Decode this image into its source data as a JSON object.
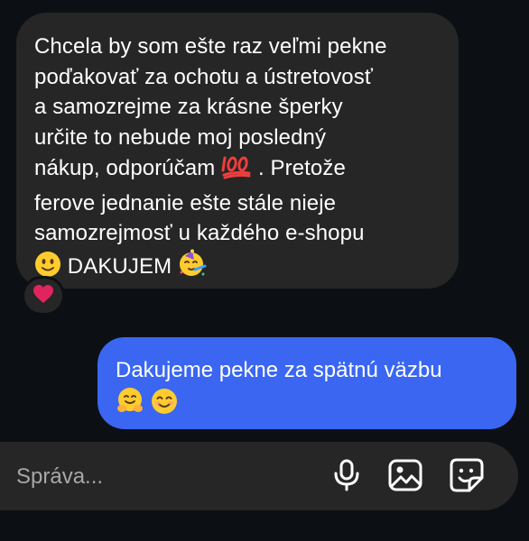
{
  "incoming_message": {
    "line1": "Chcela by som ešte raz veľmi pekne",
    "line2": "poďakovať za ochotu a ústretovosť",
    "line3": "a samozrejme za krásne šperky",
    "line4": "určite to nebude moj posledný",
    "line5a": "nákup, odporúčam",
    "line5b": ". Pretože",
    "line6": "ferove jednanie ešte stále nieje",
    "line7": "samozrejmosť u každého e-shopu",
    "line8": "DAKUJEM",
    "reaction_icon": "heart",
    "reaction_color": "#e0245e"
  },
  "outgoing_message": {
    "line1": "Dakujeme pekne za spätnú väzbu"
  },
  "composer": {
    "placeholder": "Správa..."
  },
  "colors": {
    "background": "#0c1014",
    "incoming_bubble": "#262626",
    "outgoing_bubble": "#3a66f2"
  }
}
